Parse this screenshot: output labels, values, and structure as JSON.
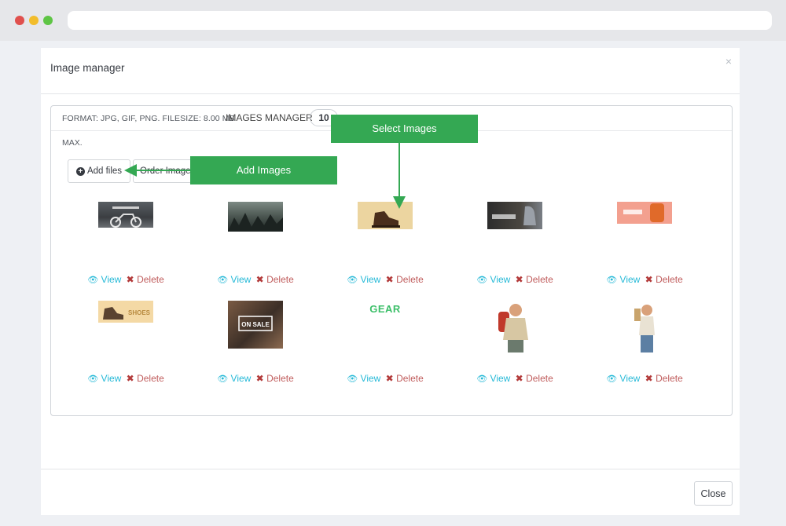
{
  "modal": {
    "title": "Image manager",
    "close_x": "×",
    "close_button": "Close"
  },
  "panel": {
    "format_text": "FORMAT: JPG, GIF, PNG. FILESIZE: 8.00 MB",
    "max_text": "MAX.",
    "title": "IMAGES MANAGER",
    "count": "10",
    "add_files_label": "Add files",
    "order_images_label": "Order Images"
  },
  "images": [
    {
      "view": "View",
      "delete": "Delete"
    },
    {
      "view": "View",
      "delete": "Delete"
    },
    {
      "view": "View",
      "delete": "Delete"
    },
    {
      "view": "View",
      "delete": "Delete"
    },
    {
      "view": "View",
      "delete": "Delete"
    },
    {
      "view": "View",
      "delete": "Delete",
      "caption": "SHOES"
    },
    {
      "view": "View",
      "delete": "Delete",
      "caption": "ON SALE"
    },
    {
      "view": "View",
      "delete": "Delete",
      "caption": "GEAR"
    },
    {
      "view": "View",
      "delete": "Delete"
    },
    {
      "view": "View",
      "delete": "Delete"
    }
  ],
  "callouts": {
    "add_images": "Add Images",
    "select_images": "Select Images"
  },
  "colors": {
    "callout_green": "#34a853",
    "link_blue": "#25b9d7",
    "delete_red": "#c05c5c"
  }
}
